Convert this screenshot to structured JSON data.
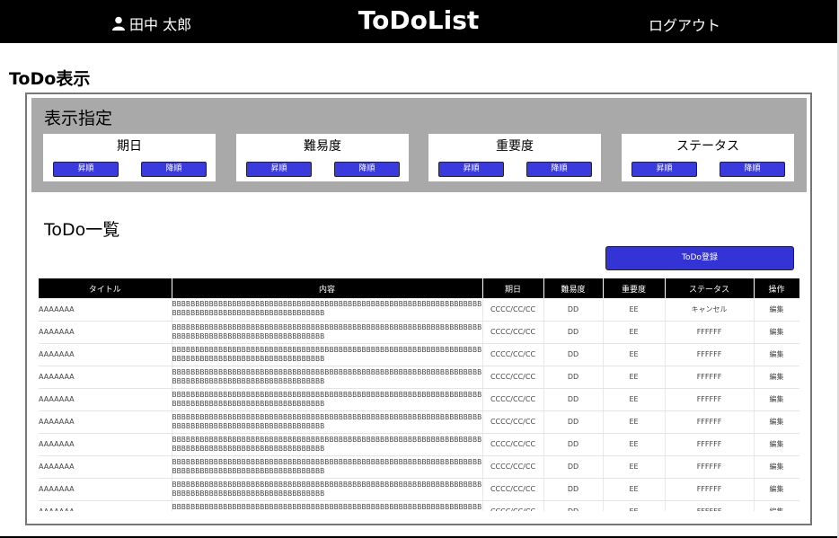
{
  "header": {
    "user_name": "田中 太郎",
    "brand": "ToDoList",
    "logout_label": "ログアウト"
  },
  "page_title": "ToDo表示",
  "filter": {
    "title": "表示指定",
    "cards": [
      {
        "label": "期日",
        "asc": "昇順",
        "desc": "降順"
      },
      {
        "label": "難易度",
        "asc": "昇順",
        "desc": "降順"
      },
      {
        "label": "重要度",
        "asc": "昇順",
        "desc": "降順"
      },
      {
        "label": "ステータス",
        "asc": "昇順",
        "desc": "降順"
      }
    ]
  },
  "list": {
    "title": "ToDo一覧",
    "register_label": "ToDo登録",
    "columns": [
      "タイトル",
      "内容",
      "期日",
      "難易度",
      "重要度",
      "ステータス",
      "操作"
    ],
    "rows": [
      {
        "title": "AAAAAAA",
        "body": "BBBBBBBBBBBBBBBBBBBBBBBBBBBBBBBBBBBBBBBBBBBBBBBBBBBBBBBBBBBBBBBBBBBBBBBBBBBBBBBBBBBBBBBBBBBBBBBBBBBB",
        "due": "CCCC/CC/CC",
        "difficulty": "DD",
        "importance": "EE",
        "status": "キャンセル",
        "action": "編集"
      },
      {
        "title": "AAAAAAA",
        "body": "BBBBBBBBBBBBBBBBBBBBBBBBBBBBBBBBBBBBBBBBBBBBBBBBBBBBBBBBBBBBBBBBBBBBBBBBBBBBBBBBBBBBBBBBBBBBBBBBBBBB",
        "due": "CCCC/CC/CC",
        "difficulty": "DD",
        "importance": "EE",
        "status": "FFFFFF",
        "action": "編集"
      },
      {
        "title": "AAAAAAA",
        "body": "BBBBBBBBBBBBBBBBBBBBBBBBBBBBBBBBBBBBBBBBBBBBBBBBBBBBBBBBBBBBBBBBBBBBBBBBBBBBBBBBBBBBBBBBBBBBBBBBBBBB",
        "due": "CCCC/CC/CC",
        "difficulty": "DD",
        "importance": "EE",
        "status": "FFFFFF",
        "action": "編集"
      },
      {
        "title": "AAAAAAA",
        "body": "BBBBBBBBBBBBBBBBBBBBBBBBBBBBBBBBBBBBBBBBBBBBBBBBBBBBBBBBBBBBBBBBBBBBBBBBBBBBBBBBBBBBBBBBBBBBBBBBBBBB",
        "due": "CCCC/CC/CC",
        "difficulty": "DD",
        "importance": "EE",
        "status": "FFFFFF",
        "action": "編集"
      },
      {
        "title": "AAAAAAA",
        "body": "BBBBBBBBBBBBBBBBBBBBBBBBBBBBBBBBBBBBBBBBBBBBBBBBBBBBBBBBBBBBBBBBBBBBBBBBBBBBBBBBBBBBBBBBBBBBBBBBBBBB",
        "due": "CCCC/CC/CC",
        "difficulty": "DD",
        "importance": "EE",
        "status": "FFFFFF",
        "action": "編集"
      },
      {
        "title": "AAAAAAA",
        "body": "BBBBBBBBBBBBBBBBBBBBBBBBBBBBBBBBBBBBBBBBBBBBBBBBBBBBBBBBBBBBBBBBBBBBBBBBBBBBBBBBBBBBBBBBBBBBBBBBBBBB",
        "due": "CCCC/CC/CC",
        "difficulty": "DD",
        "importance": "EE",
        "status": "FFFFFF",
        "action": "編集"
      },
      {
        "title": "AAAAAAA",
        "body": "BBBBBBBBBBBBBBBBBBBBBBBBBBBBBBBBBBBBBBBBBBBBBBBBBBBBBBBBBBBBBBBBBBBBBBBBBBBBBBBBBBBBBBBBBBBBBBBBBBBB",
        "due": "CCCC/CC/CC",
        "difficulty": "DD",
        "importance": "EE",
        "status": "FFFFFF",
        "action": "編集"
      },
      {
        "title": "AAAAAAA",
        "body": "BBBBBBBBBBBBBBBBBBBBBBBBBBBBBBBBBBBBBBBBBBBBBBBBBBBBBBBBBBBBBBBBBBBBBBBBBBBBBBBBBBBBBBBBBBBBBBBBBBBB",
        "due": "CCCC/CC/CC",
        "difficulty": "DD",
        "importance": "EE",
        "status": "FFFFFF",
        "action": "編集"
      },
      {
        "title": "AAAAAAA",
        "body": "BBBBBBBBBBBBBBBBBBBBBBBBBBBBBBBBBBBBBBBBBBBBBBBBBBBBBBBBBBBBBBBBBBBBBBBBBBBBBBBBBBBBBBBBBBBBBBBBBBBB",
        "due": "CCCC/CC/CC",
        "difficulty": "DD",
        "importance": "EE",
        "status": "FFFFFF",
        "action": "編集"
      },
      {
        "title": "AAAAAAA",
        "body": "BBBBBBBBBBBBBBBBBBBBBBBBBBBBBBBBBBBBBBBBBBBBBBBBBBBBBBBBBBBBBBBBBBBBBBBBBBBBBBBBBBBBBBBBBBBBBBBBBBBB",
        "due": "CCCC/CC/CC",
        "difficulty": "DD",
        "importance": "EE",
        "status": "FFFFFF",
        "action": "編集"
      }
    ]
  },
  "colors": {
    "header_bg": "#000000",
    "filter_bg": "#a9a9a9",
    "button_blue": "#3a3adf"
  }
}
